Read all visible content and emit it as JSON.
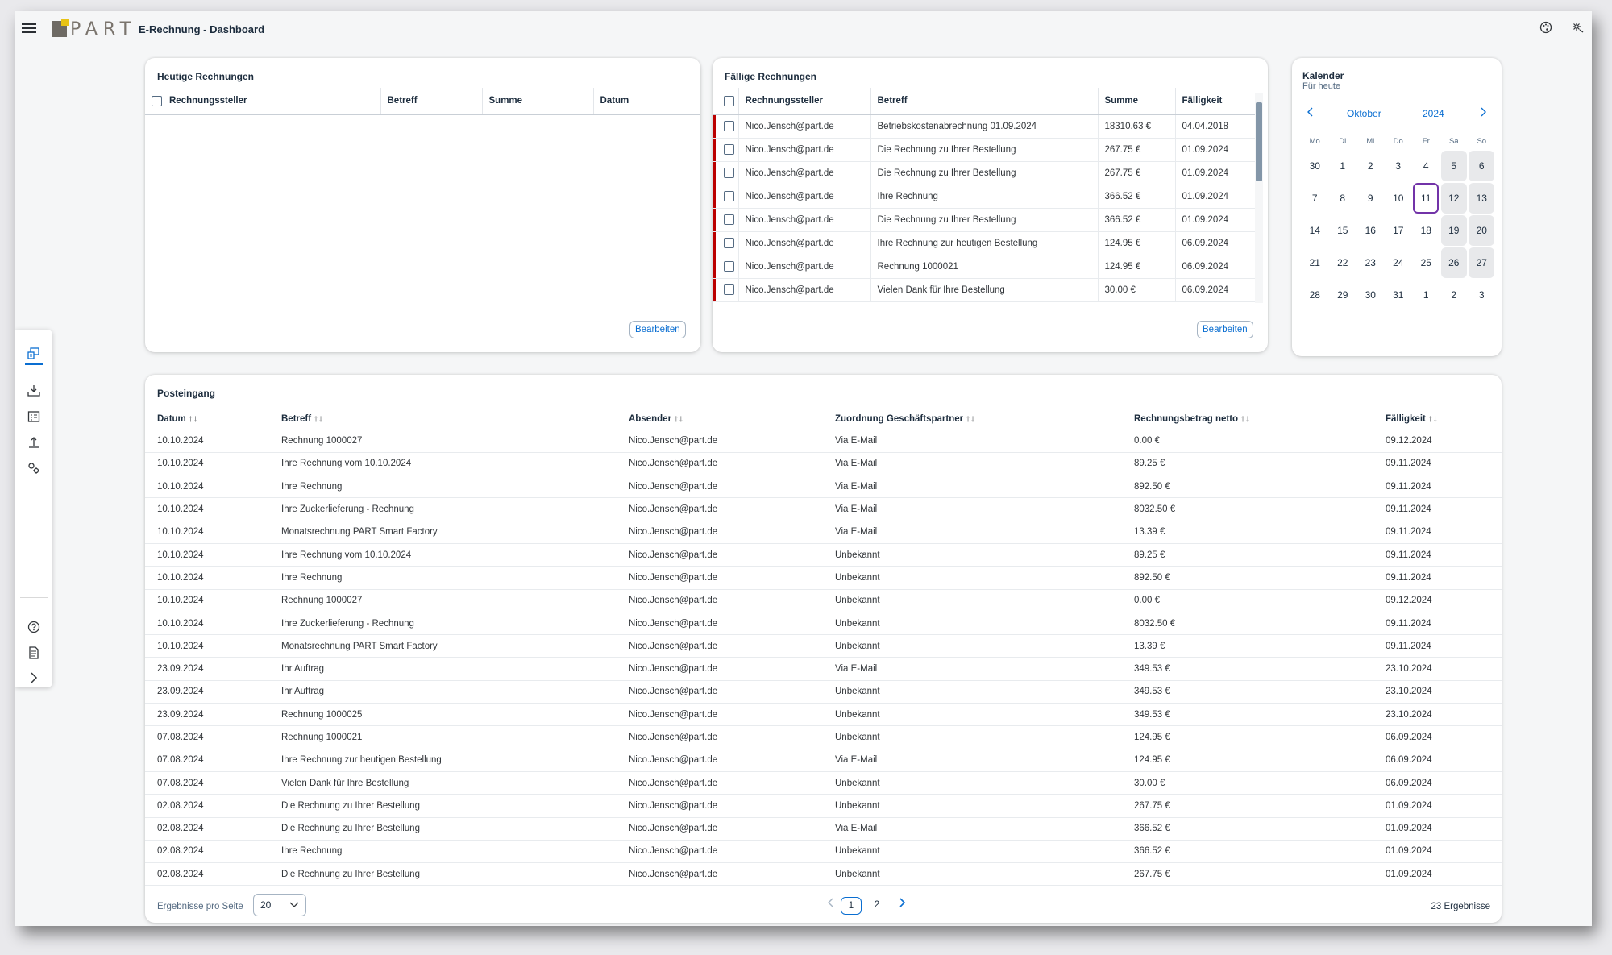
{
  "header": {
    "logo_text": "PART",
    "title": "E-Rechnung - Dashboard",
    "icons": [
      "palette-icon",
      "settings-icon"
    ]
  },
  "rail": {
    "items": [
      "dashboard-icon",
      "inbox-download-icon",
      "invoice-list-icon",
      "upload-icon",
      "partner-settings-icon",
      "help-icon",
      "document-icon",
      "expand-icon"
    ]
  },
  "heutige": {
    "title": "Heutige Rechnungen",
    "columns": [
      "Rechnungssteller",
      "Betreff",
      "Summe",
      "Datum"
    ],
    "rows": [],
    "button": "Bearbeiten"
  },
  "faellige": {
    "title": "Fällige Rechnungen",
    "columns": [
      "Rechnungssteller",
      "Betreff",
      "Summe",
      "Fälligkeit"
    ],
    "rows": [
      {
        "sender": "Nico.Jensch@part.de",
        "subject": "Betriebskostenabrechnung 01.09.2024",
        "sum": "18310.63 €",
        "due": "04.04.2018"
      },
      {
        "sender": "Nico.Jensch@part.de",
        "subject": "Die Rechnung zu Ihrer Bestellung",
        "sum": "267.75 €",
        "due": "01.09.2024"
      },
      {
        "sender": "Nico.Jensch@part.de",
        "subject": "Die Rechnung zu Ihrer Bestellung",
        "sum": "267.75 €",
        "due": "01.09.2024"
      },
      {
        "sender": "Nico.Jensch@part.de",
        "subject": "Ihre Rechnung",
        "sum": "366.52 €",
        "due": "01.09.2024"
      },
      {
        "sender": "Nico.Jensch@part.de",
        "subject": "Die Rechnung zu Ihrer Bestellung",
        "sum": "366.52 €",
        "due": "01.09.2024"
      },
      {
        "sender": "Nico.Jensch@part.de",
        "subject": "Ihre Rechnung zur heutigen Bestellung",
        "sum": "124.95 €",
        "due": "06.09.2024"
      },
      {
        "sender": "Nico.Jensch@part.de",
        "subject": "Rechnung 1000021",
        "sum": "124.95 €",
        "due": "06.09.2024"
      },
      {
        "sender": "Nico.Jensch@part.de",
        "subject": "Vielen Dank für Ihre Bestellung",
        "sum": "30.00 €",
        "due": "06.09.2024"
      }
    ],
    "button": "Bearbeiten",
    "status_color": "#bb0000"
  },
  "kalender": {
    "title": "Kalender",
    "subtitle": "Für heute",
    "month": "Oktober",
    "year": "2024",
    "weekdays": [
      "Mo",
      "Di",
      "Mi",
      "Do",
      "Fr",
      "Sa",
      "So"
    ],
    "weeks": [
      [
        "30",
        "1",
        "2",
        "3",
        "4",
        "5",
        "6"
      ],
      [
        "7",
        "8",
        "9",
        "10",
        "11",
        "12",
        "13"
      ],
      [
        "14",
        "15",
        "16",
        "17",
        "18",
        "19",
        "20"
      ],
      [
        "21",
        "22",
        "23",
        "24",
        "25",
        "26",
        "27"
      ],
      [
        "28",
        "29",
        "30",
        "31",
        "1",
        "2",
        "3"
      ]
    ],
    "today": "11",
    "today_color": "#7233a8"
  },
  "posteingang": {
    "title": "Posteingang",
    "columns": [
      "Datum",
      "Betreff",
      "Absender",
      "Zuordnung Geschäftspartner",
      "Rechnungsbetrag netto",
      "Fälligkeit"
    ],
    "rows": [
      {
        "date": "10.10.2024",
        "subject": "Rechnung 1000027",
        "sender": "Nico.Jensch@part.de",
        "partner": "Via E-Mail",
        "amount": "0.00 €",
        "due": "09.12.2024"
      },
      {
        "date": "10.10.2024",
        "subject": "Ihre Rechnung vom 10.10.2024",
        "sender": "Nico.Jensch@part.de",
        "partner": "Via E-Mail",
        "amount": "89.25 €",
        "due": "09.11.2024"
      },
      {
        "date": "10.10.2024",
        "subject": "Ihre Rechnung",
        "sender": "Nico.Jensch@part.de",
        "partner": "Via E-Mail",
        "amount": "892.50 €",
        "due": "09.11.2024"
      },
      {
        "date": "10.10.2024",
        "subject": "Ihre Zuckerlieferung - Rechnung",
        "sender": "Nico.Jensch@part.de",
        "partner": "Via E-Mail",
        "amount": "8032.50 €",
        "due": "09.11.2024"
      },
      {
        "date": "10.10.2024",
        "subject": "Monatsrechnung PART Smart Factory",
        "sender": "Nico.Jensch@part.de",
        "partner": "Via E-Mail",
        "amount": "13.39 €",
        "due": "09.11.2024"
      },
      {
        "date": "10.10.2024",
        "subject": "Ihre Rechnung vom 10.10.2024",
        "sender": "Nico.Jensch@part.de",
        "partner": "Unbekannt",
        "amount": "89.25 €",
        "due": "09.11.2024"
      },
      {
        "date": "10.10.2024",
        "subject": "Ihre Rechnung",
        "sender": "Nico.Jensch@part.de",
        "partner": "Unbekannt",
        "amount": "892.50 €",
        "due": "09.11.2024"
      },
      {
        "date": "10.10.2024",
        "subject": "Rechnung 1000027",
        "sender": "Nico.Jensch@part.de",
        "partner": "Unbekannt",
        "amount": "0.00 €",
        "due": "09.12.2024"
      },
      {
        "date": "10.10.2024",
        "subject": "Ihre Zuckerlieferung - Rechnung",
        "sender": "Nico.Jensch@part.de",
        "partner": "Unbekannt",
        "amount": "8032.50 €",
        "due": "09.11.2024"
      },
      {
        "date": "10.10.2024",
        "subject": "Monatsrechnung PART Smart Factory",
        "sender": "Nico.Jensch@part.de",
        "partner": "Unbekannt",
        "amount": "13.39 €",
        "due": "09.11.2024"
      },
      {
        "date": "23.09.2024",
        "subject": "Ihr Auftrag",
        "sender": "Nico.Jensch@part.de",
        "partner": "Via E-Mail",
        "amount": "349.53 €",
        "due": "23.10.2024"
      },
      {
        "date": "23.09.2024",
        "subject": "Ihr Auftrag",
        "sender": "Nico.Jensch@part.de",
        "partner": "Unbekannt",
        "amount": "349.53 €",
        "due": "23.10.2024"
      },
      {
        "date": "23.09.2024",
        "subject": "Rechnung 1000025",
        "sender": "Nico.Jensch@part.de",
        "partner": "Unbekannt",
        "amount": "349.53 €",
        "due": "23.10.2024"
      },
      {
        "date": "07.08.2024",
        "subject": "Rechnung 1000021",
        "sender": "Nico.Jensch@part.de",
        "partner": "Unbekannt",
        "amount": "124.95 €",
        "due": "06.09.2024"
      },
      {
        "date": "07.08.2024",
        "subject": "Ihre Rechnung zur heutigen Bestellung",
        "sender": "Nico.Jensch@part.de",
        "partner": "Via E-Mail",
        "amount": "124.95 €",
        "due": "06.09.2024"
      },
      {
        "date": "07.08.2024",
        "subject": "Vielen Dank für Ihre Bestellung",
        "sender": "Nico.Jensch@part.de",
        "partner": "Unbekannt",
        "amount": "30.00 €",
        "due": "06.09.2024"
      },
      {
        "date": "02.08.2024",
        "subject": "Die Rechnung zu Ihrer Bestellung",
        "sender": "Nico.Jensch@part.de",
        "partner": "Unbekannt",
        "amount": "267.75 €",
        "due": "01.09.2024"
      },
      {
        "date": "02.08.2024",
        "subject": "Die Rechnung zu Ihrer Bestellung",
        "sender": "Nico.Jensch@part.de",
        "partner": "Via E-Mail",
        "amount": "366.52 €",
        "due": "01.09.2024"
      },
      {
        "date": "02.08.2024",
        "subject": "Ihre Rechnung",
        "sender": "Nico.Jensch@part.de",
        "partner": "Unbekannt",
        "amount": "366.52 €",
        "due": "01.09.2024"
      },
      {
        "date": "02.08.2024",
        "subject": "Die Rechnung zu Ihrer Bestellung",
        "sender": "Nico.Jensch@part.de",
        "partner": "Unbekannt",
        "amount": "267.75 €",
        "due": "01.09.2024"
      }
    ],
    "per_page_label": "Ergebnisse pro Seite",
    "per_page_value": "20",
    "pages": [
      "1",
      "2"
    ],
    "current_page": "1",
    "results": "23 Ergebnisse"
  }
}
